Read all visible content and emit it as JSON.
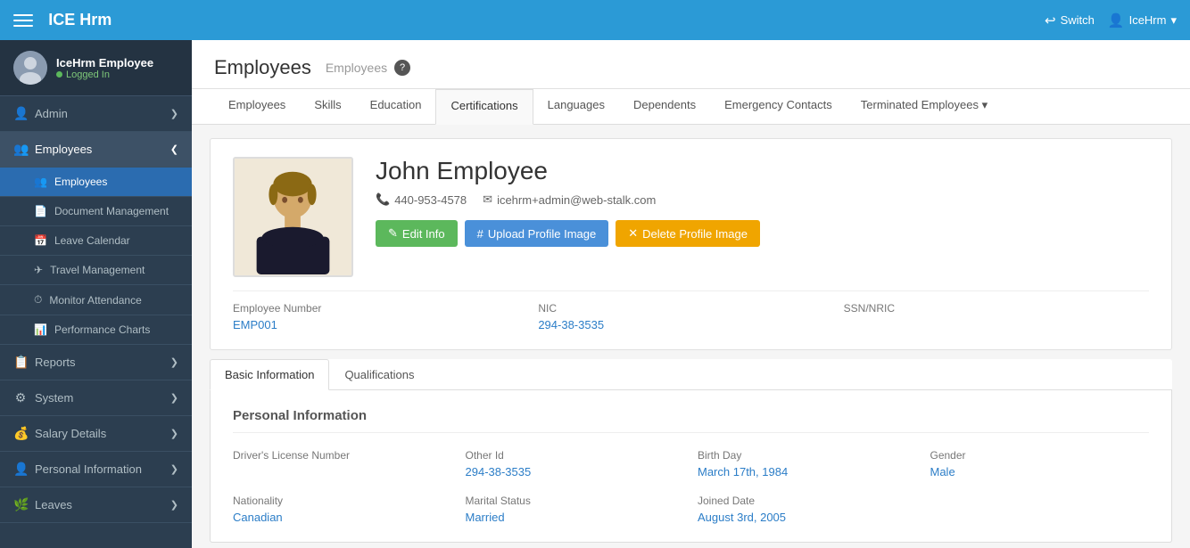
{
  "app": {
    "title": "ICE Hrm"
  },
  "navbar": {
    "brand": "ICE Hrm",
    "switch_label": "Switch",
    "user_label": "IceHrm",
    "user_dropdown_icon": "▾"
  },
  "sidebar": {
    "user": {
      "name": "IceHrm Employee",
      "status": "Logged In"
    },
    "menu": [
      {
        "id": "admin",
        "label": "Admin",
        "icon": "👤",
        "chevron": "❯",
        "active": false
      },
      {
        "id": "employees",
        "label": "Employees",
        "icon": "👥",
        "chevron": "❮",
        "active": true
      },
      {
        "id": "employees-sub",
        "label": "Employees",
        "icon": "👥",
        "sub": true,
        "active": true
      },
      {
        "id": "document-management",
        "label": "Document Management",
        "icon": "📄",
        "sub": true
      },
      {
        "id": "leave-calendar",
        "label": "Leave Calendar",
        "icon": "📅",
        "sub": true
      },
      {
        "id": "travel-management",
        "label": "Travel Management",
        "icon": "✈",
        "sub": true
      },
      {
        "id": "monitor-attendance",
        "label": "Monitor Attendance",
        "icon": "⏱",
        "sub": true
      },
      {
        "id": "performance-charts",
        "label": "Performance Charts",
        "icon": "📊",
        "sub": true
      },
      {
        "id": "reports",
        "label": "Reports",
        "icon": "📋",
        "chevron": "❯",
        "active": false
      },
      {
        "id": "system",
        "label": "System",
        "icon": "⚙",
        "chevron": "❯",
        "active": false
      },
      {
        "id": "salary-details",
        "label": "Salary Details",
        "icon": "💰",
        "chevron": "❯",
        "active": false
      },
      {
        "id": "personal-information",
        "label": "Personal Information",
        "icon": "👤",
        "chevron": "❯",
        "active": false
      },
      {
        "id": "leaves",
        "label": "Leaves",
        "icon": "🌿",
        "chevron": "❯",
        "active": false
      }
    ]
  },
  "header": {
    "title": "Employees",
    "breadcrumb": "Employees"
  },
  "tabs": [
    {
      "id": "employees",
      "label": "Employees",
      "active": false
    },
    {
      "id": "skills",
      "label": "Skills",
      "active": false
    },
    {
      "id": "education",
      "label": "Education",
      "active": false
    },
    {
      "id": "certifications",
      "label": "Certifications",
      "active": true
    },
    {
      "id": "languages",
      "label": "Languages",
      "active": false
    },
    {
      "id": "dependents",
      "label": "Dependents",
      "active": false
    },
    {
      "id": "emergency-contacts",
      "label": "Emergency Contacts",
      "active": false
    },
    {
      "id": "terminated-employees",
      "label": "Terminated Employees ▾",
      "active": false
    }
  ],
  "employee": {
    "name": "John Employee",
    "phone": "440-953-4578",
    "email": "icehrm+admin@web-stalk.com",
    "employee_number_label": "Employee Number",
    "employee_number": "EMP001",
    "nic_label": "NIC",
    "nic": "294-38-3535",
    "ssn_label": "SSN/NRIC",
    "ssn": "",
    "buttons": {
      "edit_info": "Edit Info",
      "upload_profile_image": "Upload Profile Image",
      "delete_profile_image": "Delete Profile Image"
    }
  },
  "sub_tabs": [
    {
      "id": "basic-information",
      "label": "Basic Information",
      "active": true
    },
    {
      "id": "qualifications",
      "label": "Qualifications",
      "active": false
    }
  ],
  "personal_information": {
    "section_title": "Personal Information",
    "fields": [
      {
        "id": "drivers-license",
        "label": "Driver's License Number",
        "value": ""
      },
      {
        "id": "other-id",
        "label": "Other Id",
        "value": "294-38-3535"
      },
      {
        "id": "birthday",
        "label": "Birth Day",
        "value": "March 17th, 1984"
      },
      {
        "id": "gender",
        "label": "Gender",
        "value": "Male"
      },
      {
        "id": "nationality",
        "label": "Nationality",
        "value": "Canadian"
      },
      {
        "id": "marital-status",
        "label": "Marital Status",
        "value": "Married"
      },
      {
        "id": "joined-date",
        "label": "Joined Date",
        "value": "August 3rd, 2005"
      }
    ]
  },
  "colors": {
    "primary": "#2b9ad6",
    "link": "#2b7dc7",
    "green": "#5cb85c",
    "orange": "#f0a500"
  }
}
